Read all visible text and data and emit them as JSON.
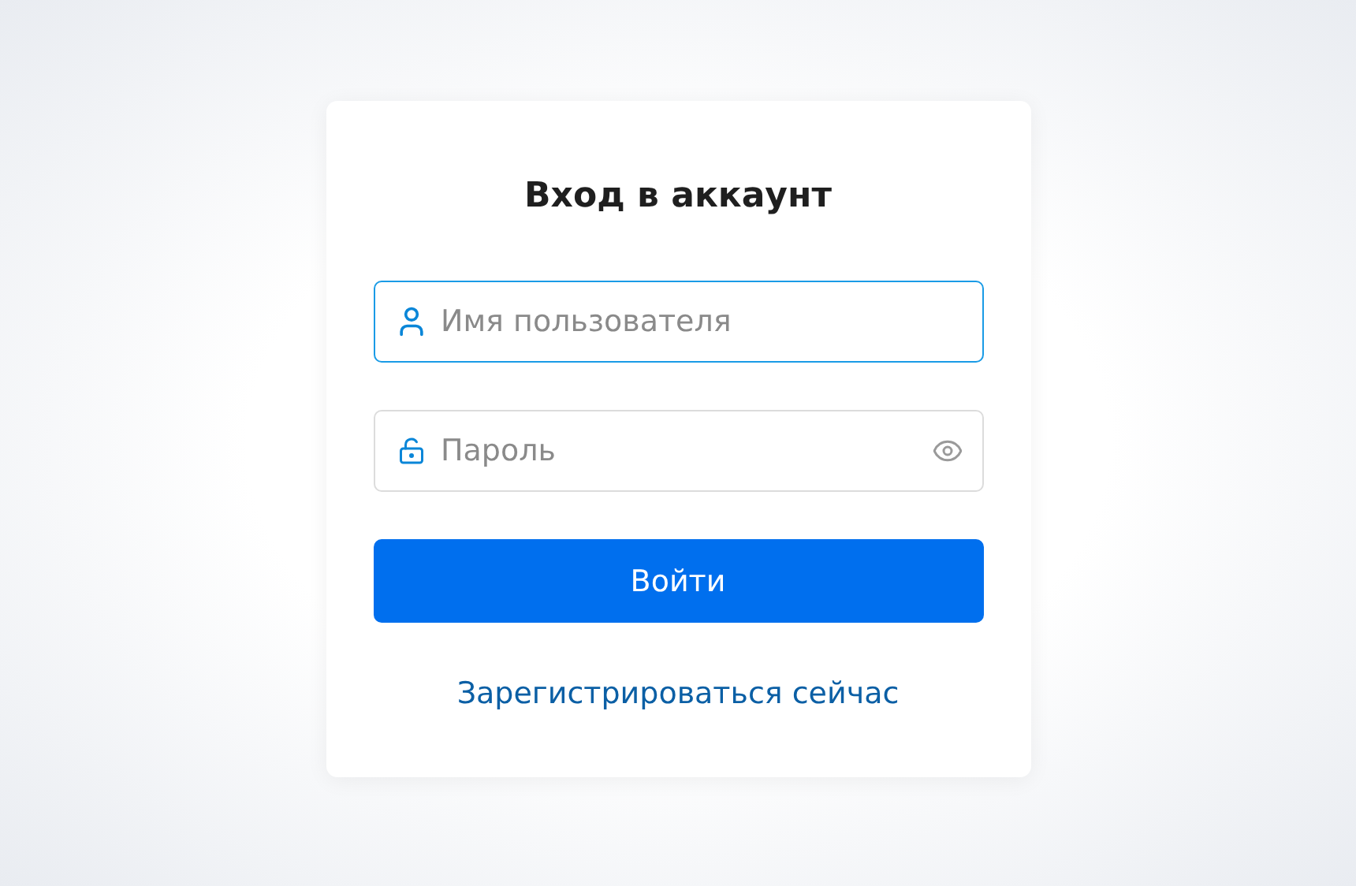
{
  "login_form": {
    "title": "Вход в аккаунт",
    "fields": [
      {
        "kind": "username",
        "placeholder": "Имя пользователя",
        "focused": true
      },
      {
        "kind": "password",
        "placeholder": "Пароль",
        "focused": false
      }
    ],
    "submit_button": "Войти",
    "register_link": "Зарегистрироваться сейчас"
  }
}
